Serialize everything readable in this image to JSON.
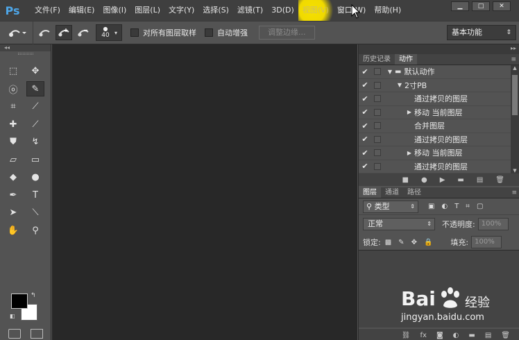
{
  "app": {
    "logo": "Ps"
  },
  "menu": [
    "文件(F)",
    "编辑(E)",
    "图像(I)",
    "图层(L)",
    "文字(Y)",
    "选择(S)",
    "滤镜(T)",
    "3D(D)",
    "视图(V)",
    "窗口(W)",
    "帮助(H)"
  ],
  "menu_highlight_color": "#f5e000",
  "options": {
    "brush_size": "40",
    "sample_all_label": "对所有图层取样",
    "auto_enhance_label": "自动增强",
    "refine_edge_label": "调整边缘...",
    "workspace": "基本功能"
  },
  "tool_icons": [
    [
      "marquee-icon",
      "move-icon"
    ],
    [
      "lasso-icon",
      "quick-selection-icon"
    ],
    [
      "crop-icon",
      "eyedropper-icon"
    ],
    [
      "healing-brush-icon",
      "brush-icon"
    ],
    [
      "clone-stamp-icon",
      "history-brush-icon"
    ],
    [
      "eraser-icon",
      "gradient-icon"
    ],
    [
      "blur-icon",
      "dodge-icon"
    ],
    [
      "pen-icon",
      "type-icon"
    ],
    [
      "path-selection-icon",
      "line-icon"
    ],
    [
      "hand-icon",
      "zoom-icon"
    ]
  ],
  "panels": {
    "history_tab": "历史记录",
    "actions_tab": "动作",
    "actions": [
      {
        "level": 0,
        "arrow": "▼",
        "folder": true,
        "label": "默认动作"
      },
      {
        "level": 1,
        "arrow": "▼",
        "folder": false,
        "label": "2寸PB"
      },
      {
        "level": 2,
        "arrow": "",
        "folder": false,
        "label": "通过拷贝的图层"
      },
      {
        "level": 2,
        "arrow": "▶",
        "folder": false,
        "label": "移动 当前图层"
      },
      {
        "level": 2,
        "arrow": "",
        "folder": false,
        "label": "合并图层"
      },
      {
        "level": 2,
        "arrow": "",
        "folder": false,
        "label": "通过拷贝的图层"
      },
      {
        "level": 2,
        "arrow": "▶",
        "folder": false,
        "label": "移动 当前图层"
      },
      {
        "level": 2,
        "arrow": "",
        "folder": false,
        "label": "通过拷贝的图层"
      }
    ],
    "layers_tab": "图层",
    "channels_tab": "通道",
    "paths_tab": "路径",
    "filter_kind": "类型",
    "blend_mode": "正常",
    "opacity_label": "不透明度:",
    "opacity_value": "100%",
    "lock_label": "锁定:",
    "fill_label": "填充:",
    "fill_value": "100%"
  },
  "watermark": {
    "brand": "Bai",
    "brand2": "经验",
    "url": "jingyan.baidu.com"
  }
}
